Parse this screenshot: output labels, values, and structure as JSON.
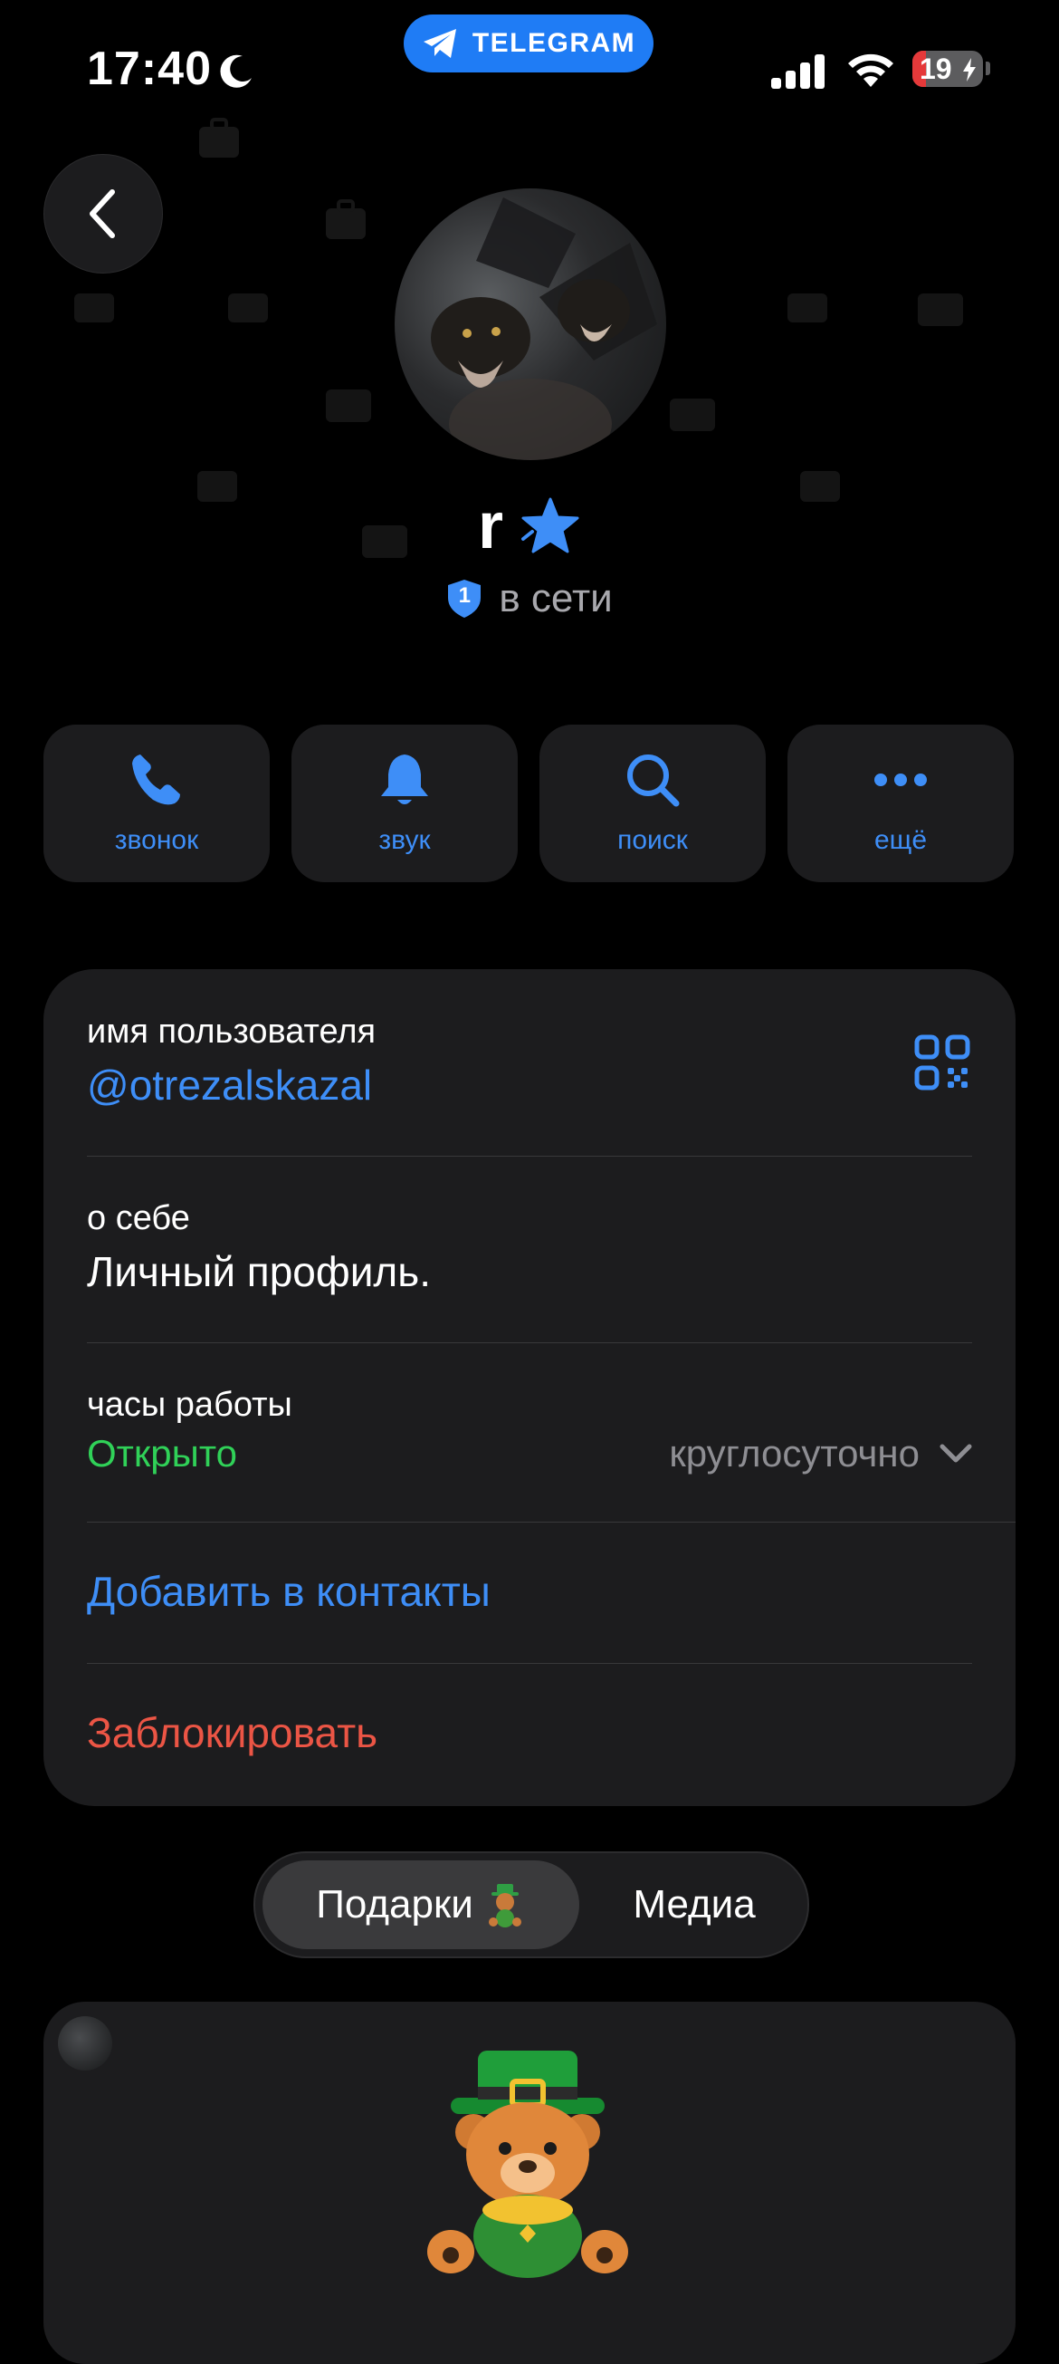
{
  "status_bar": {
    "time": "17:40",
    "battery": "19",
    "battery_level": 0.19
  },
  "app_pill": {
    "label": "TELEGRAM"
  },
  "profile": {
    "name": "r",
    "badge_count": "1",
    "status": "в сети"
  },
  "actions": [
    {
      "label": "звонок",
      "icon": "phone-icon"
    },
    {
      "label": "звук",
      "icon": "bell-icon"
    },
    {
      "label": "поиск",
      "icon": "search-icon"
    },
    {
      "label": "ещё",
      "icon": "ellipsis-icon"
    }
  ],
  "info": {
    "username_label": "имя пользователя",
    "username": "@otrezalskazal",
    "about_label": "о себе",
    "about": "Личный профиль.",
    "hours_label": "часы работы",
    "hours_status": "Открыто",
    "hours_value": "круглосуточно",
    "add_contact": "Добавить в контакты",
    "block": "Заблокировать"
  },
  "tabs": {
    "gifts": "Подарки",
    "media": "Медиа"
  },
  "colors": {
    "accent": "#3e8ef7",
    "green": "#30d158",
    "red": "#eb5545",
    "card": "#1c1c1e"
  }
}
